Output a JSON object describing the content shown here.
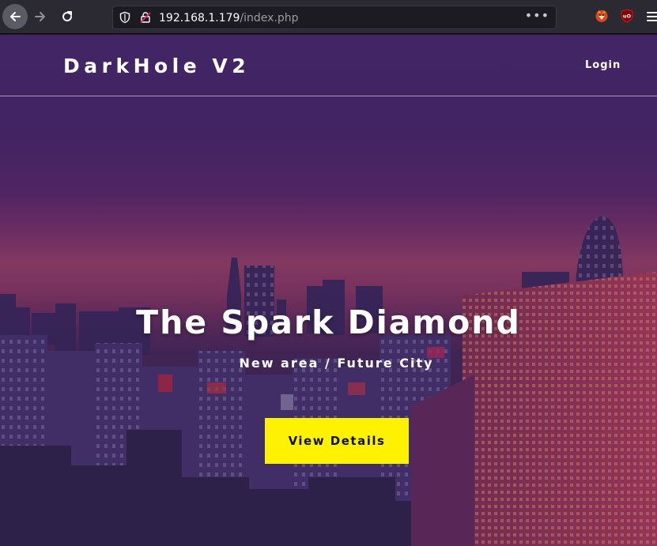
{
  "browser": {
    "url_host": "192.168.1.179",
    "url_path": "/index.php",
    "more_label": "•••",
    "icons": [
      "back-arrow-icon",
      "forward-arrow-icon",
      "reload-icon",
      "shield-icon",
      "insecure-lock-icon",
      "page-actions-icon",
      "fox-extension-icon",
      "ublock-origin-icon",
      "menu-icon"
    ]
  },
  "site": {
    "brand": "DarkHole V2",
    "nav_login": "Login"
  },
  "hero": {
    "title": "The Spark Diamond",
    "subtitle": "New area / Future City",
    "cta_label": "View Details"
  },
  "colors": {
    "overlay": "#4a2b6e",
    "cta_background": "#fff200",
    "text": "#ffffff"
  }
}
